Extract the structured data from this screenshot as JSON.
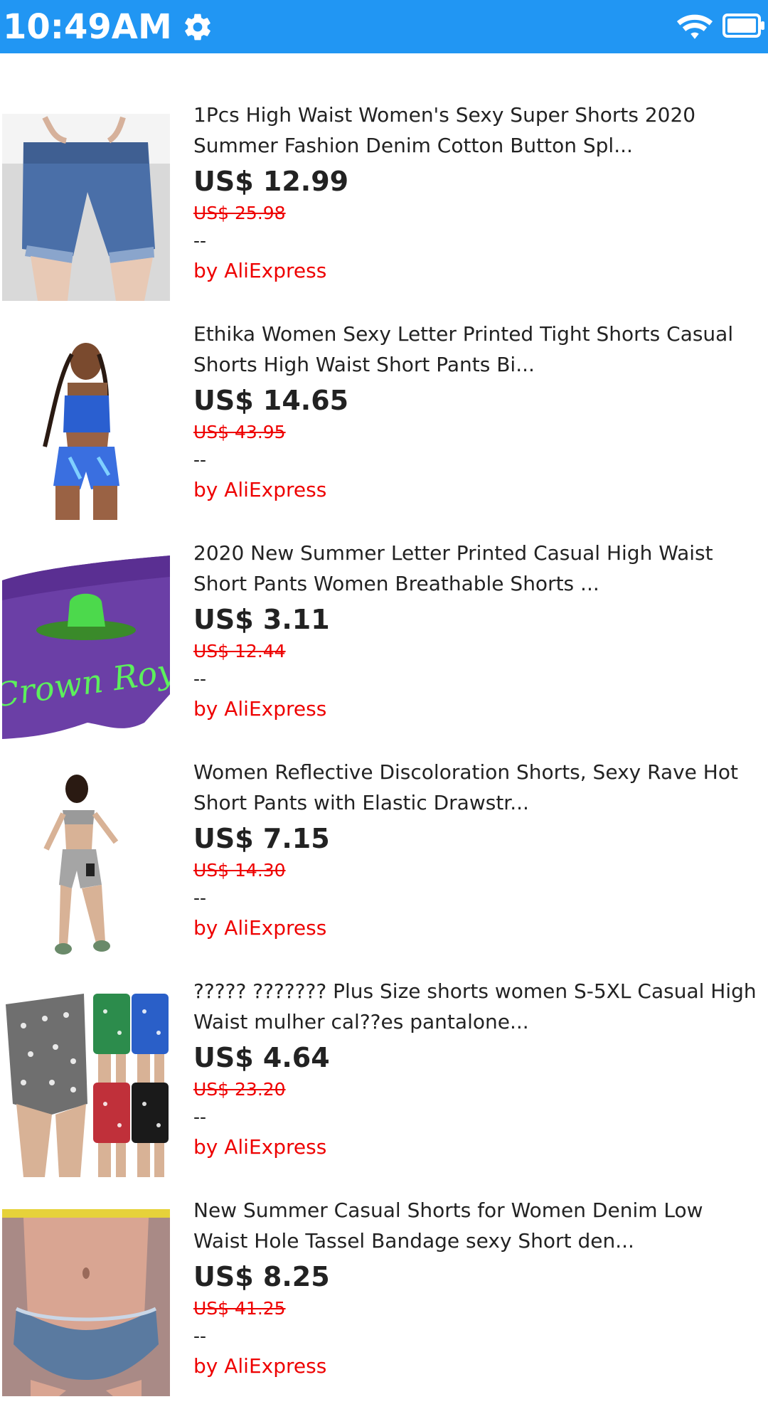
{
  "status_bar": {
    "time": "10:49AM",
    "icons": [
      "gear-icon",
      "wifi-icon",
      "battery-icon"
    ],
    "color": "#2196f3"
  },
  "products": [
    {
      "title": "1Pcs High Waist Women's Sexy Super Shorts 2020 Summer Fashion Denim Cotton Button Spl...",
      "price": "US$ 12.99",
      "original_price": "US$ 25.98",
      "rating": "--",
      "seller": "by AliExpress"
    },
    {
      "title": "Ethika Women Sexy Letter Printed Tight Shorts Casual Shorts High Waist Short Pants Bi...",
      "price": "US$ 14.65",
      "original_price": "US$ 43.95",
      "rating": "--",
      "seller": "by AliExpress"
    },
    {
      "title": "2020 New Summer Letter Printed Casual High Waist Short Pants Women Breathable Shorts ...",
      "price": "US$ 3.11",
      "original_price": "US$ 12.44",
      "rating": "--",
      "seller": "by AliExpress",
      "image_text": "Crown Royal"
    },
    {
      "title": "Women Reflective Discoloration Shorts, Sexy Rave Hot Short Pants with Elastic Drawstr...",
      "price": "US$ 7.15",
      "original_price": "US$ 14.30",
      "rating": "--",
      "seller": "by AliExpress"
    },
    {
      "title": "????? ??????? Plus Size shorts women S-5XL Casual High Waist mulher cal??es pantalone...",
      "price": "US$ 4.64",
      "original_price": "US$ 23.20",
      "rating": "--",
      "seller": "by AliExpress"
    },
    {
      "title": "New Summer Casual Shorts for Women Denim Low Waist Hole Tassel Bandage sexy Short den...",
      "price": "US$ 8.25",
      "original_price": "US$ 41.25",
      "rating": "--",
      "seller": "by AliExpress"
    }
  ],
  "colors": {
    "accent": "#2196f3",
    "sale": "#ee0000",
    "text": "#222222"
  }
}
